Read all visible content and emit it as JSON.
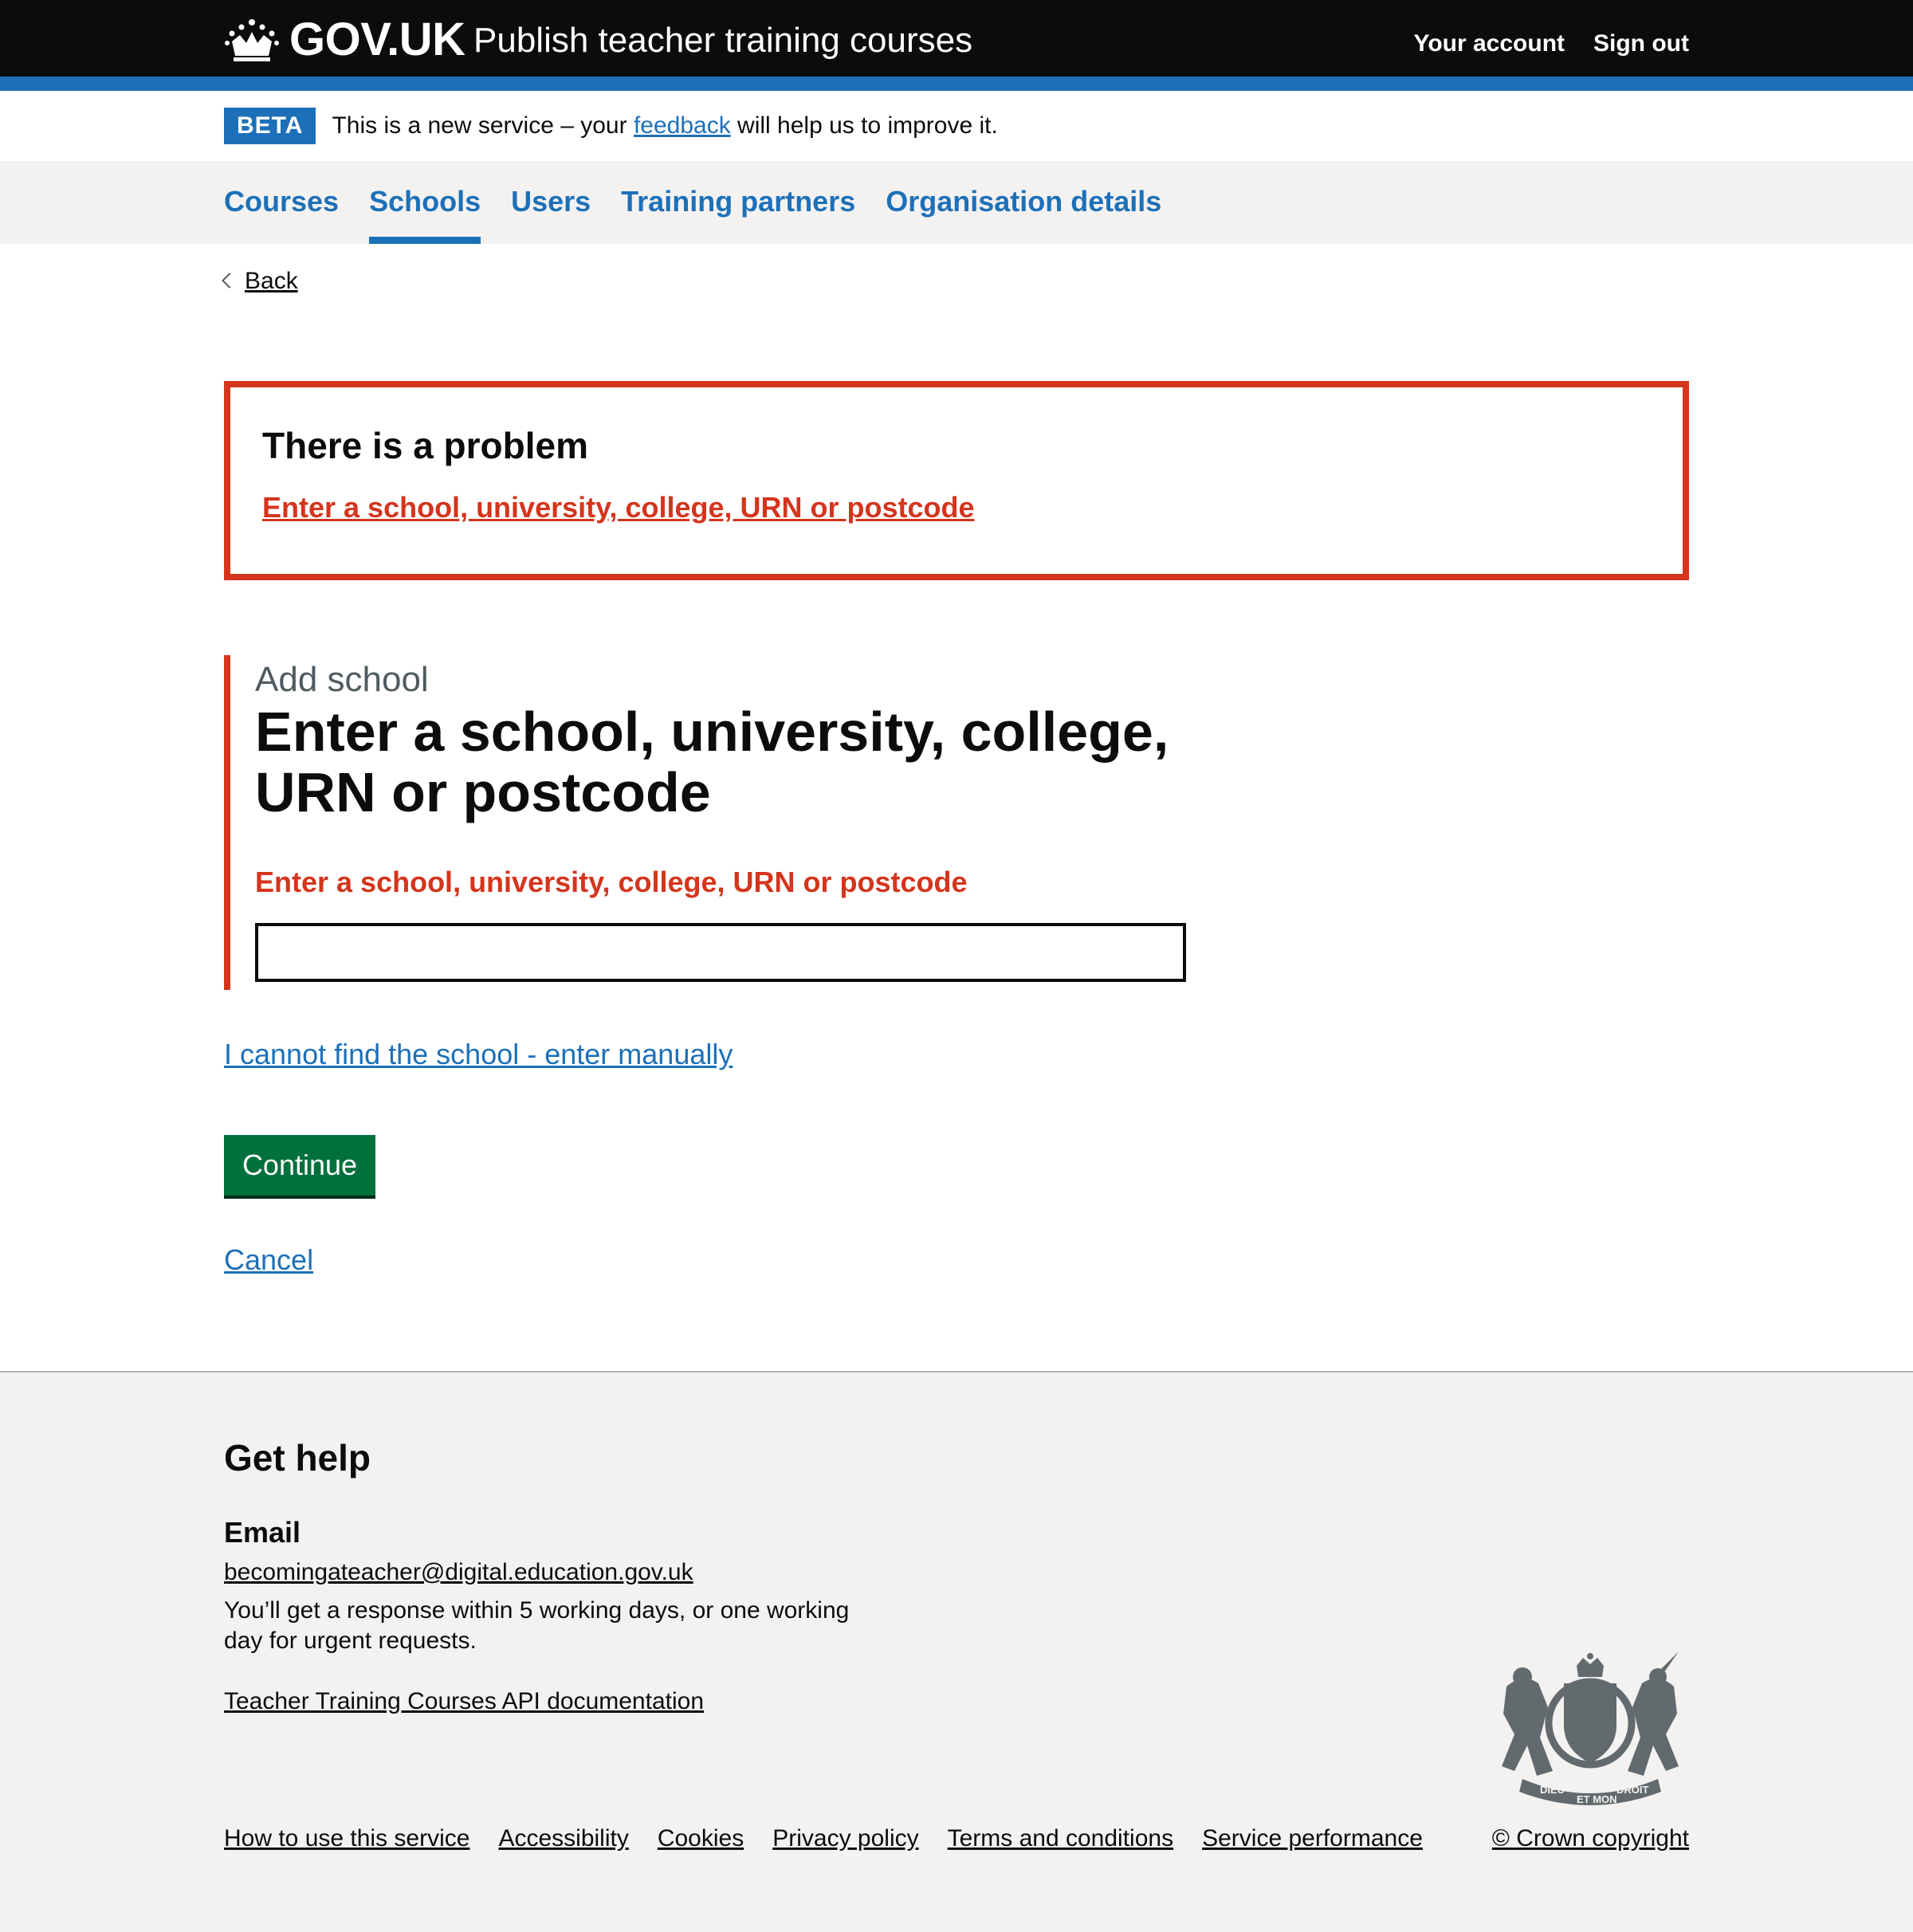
{
  "header": {
    "logo_text": "GOV.UK",
    "service_name": "Publish teacher training courses",
    "nav": [
      {
        "label": "Your account"
      },
      {
        "label": "Sign out"
      }
    ]
  },
  "beta": {
    "tag": "BETA",
    "text_before": "This is a new service – your",
    "link": "feedback",
    "text_after": "will help us to improve it."
  },
  "primary_nav": {
    "items": [
      {
        "label": "Courses",
        "active": false
      },
      {
        "label": "Schools",
        "active": true
      },
      {
        "label": "Users",
        "active": false
      },
      {
        "label": "Training partners",
        "active": false
      },
      {
        "label": "Organisation details",
        "active": false
      }
    ]
  },
  "back_link": "Back",
  "error_summary": {
    "title": "There is a problem",
    "error": "Enter a school, university, college, URN or postcode"
  },
  "form": {
    "caption": "Add school",
    "heading": "Enter a school, university, college, URN or postcode",
    "error_message": "Enter a school, university, college, URN or postcode",
    "input_value": "",
    "manual_link": "I cannot find the school - enter manually",
    "continue_label": "Continue",
    "cancel_label": "Cancel"
  },
  "footer": {
    "help_title": "Get help",
    "email_label": "Email",
    "email_address": "becomingateacher@digital.education.gov.uk",
    "response_note": "You’ll get a response within 5 working days, or one working day for urgent requests.",
    "api_link": "Teacher Training Courses API documentation",
    "links": [
      {
        "label": "How to use this service"
      },
      {
        "label": "Accessibility"
      },
      {
        "label": "Cookies"
      },
      {
        "label": "Privacy policy"
      },
      {
        "label": "Terms and conditions"
      },
      {
        "label": "Service performance"
      }
    ],
    "copyright": "© Crown copyright",
    "crest_motto": [
      "DIEU",
      "ET MON",
      "DROIT"
    ]
  },
  "colors": {
    "header_bg": "#0b0c0c",
    "brand_blue": "#1d70b8",
    "error_red": "#d4351c",
    "button_green": "#00703c",
    "footer_bg": "#f3f2f1"
  },
  "icons": [
    "crown-icon",
    "chevron-left-icon",
    "royal-crest-icon"
  ]
}
